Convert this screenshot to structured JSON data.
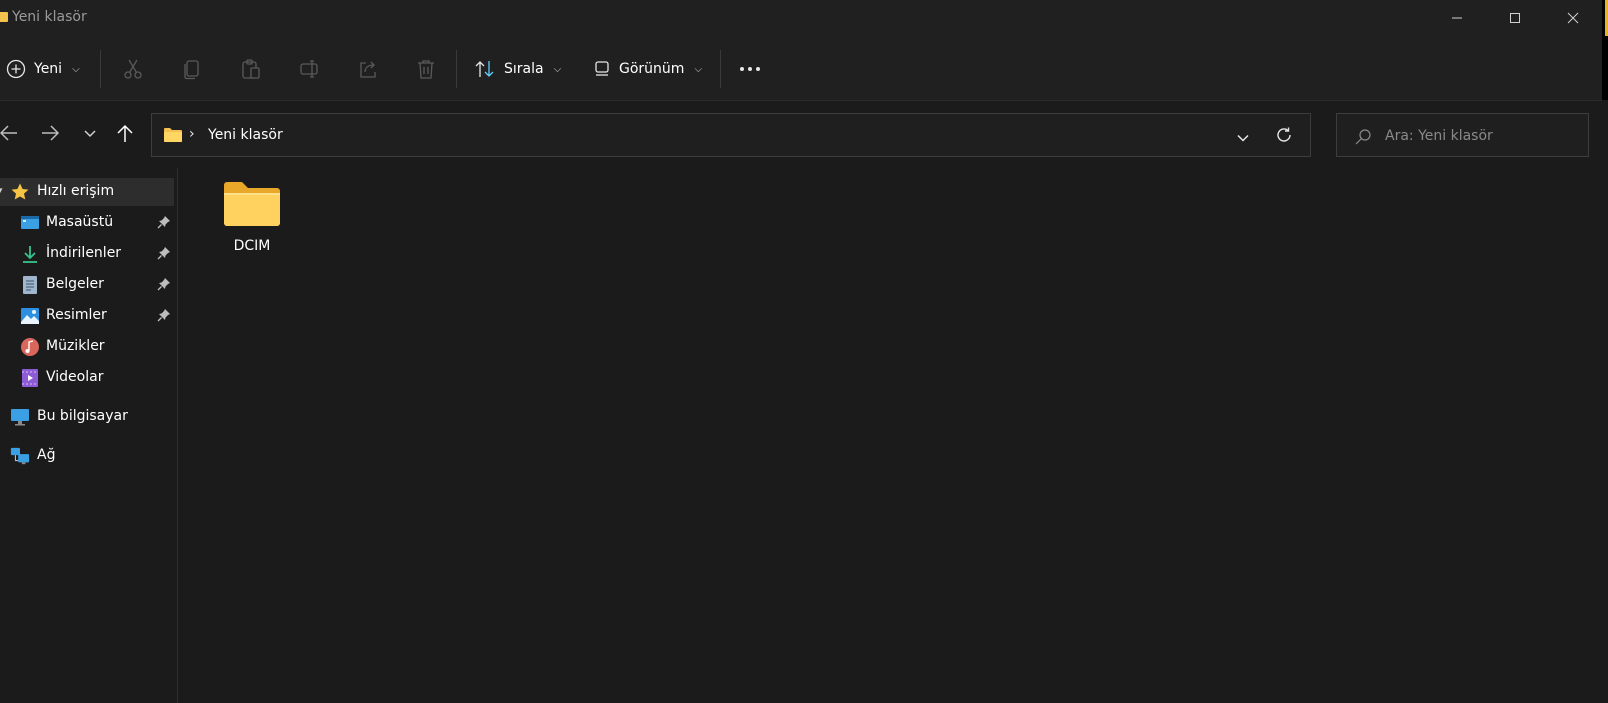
{
  "window": {
    "title": "Yeni klasör"
  },
  "toolbar": {
    "new_label": "Yeni",
    "sort_label": "Sırala",
    "view_label": "Görünüm"
  },
  "address": {
    "crumb": "Yeni klasör"
  },
  "search": {
    "placeholder": "Ara: Yeni klasör"
  },
  "sidebar": {
    "quick_access": "Hızlı erişim",
    "items": [
      {
        "label": "Masaüstü",
        "icon": "desktop-icon",
        "pinned": true
      },
      {
        "label": "İndirilenler",
        "icon": "download-icon",
        "pinned": true
      },
      {
        "label": "Belgeler",
        "icon": "documents-icon",
        "pinned": true
      },
      {
        "label": "Resimler",
        "icon": "pictures-icon",
        "pinned": true
      },
      {
        "label": "Müzikler",
        "icon": "music-icon",
        "pinned": false
      },
      {
        "label": "Videolar",
        "icon": "videos-icon",
        "pinned": false
      }
    ],
    "this_pc": "Bu bilgisayar",
    "network": "Ağ"
  },
  "content": {
    "items": [
      {
        "name": "DCIM",
        "type": "folder"
      }
    ]
  },
  "colors": {
    "background": "#1b1b1b",
    "toolbar": "#202020",
    "folder": "#f2c14e",
    "accent": "#60cdff"
  }
}
